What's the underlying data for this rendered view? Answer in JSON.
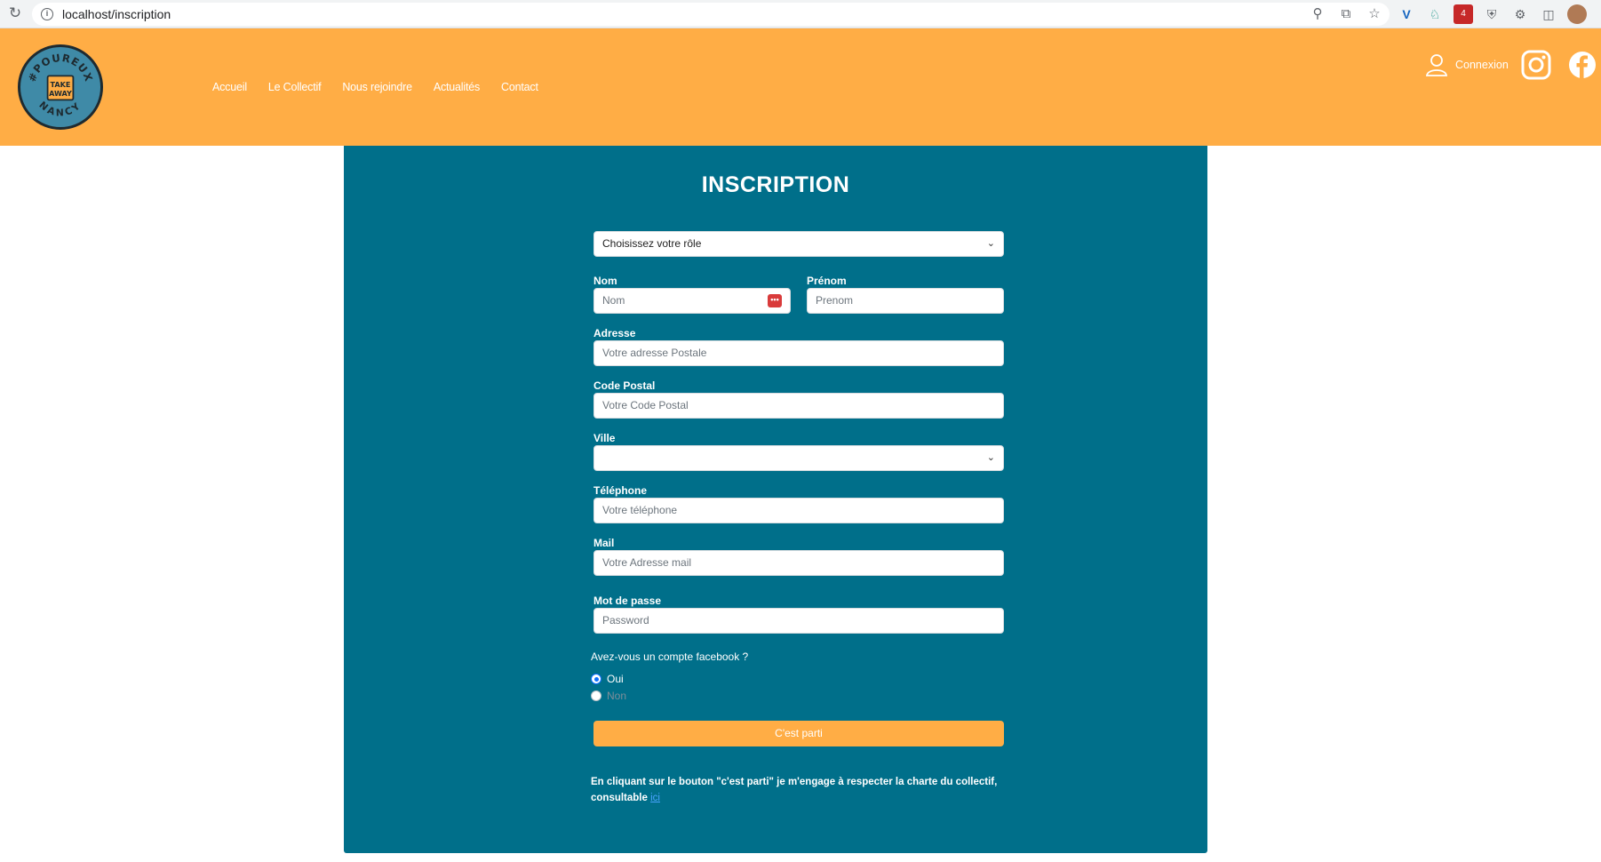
{
  "browser": {
    "url": "localhost/inscription",
    "reload_icon": "reload-icon",
    "extension_badge": "4"
  },
  "header": {
    "logo": {
      "top_text": "#POUREUX",
      "bottom_text": "NANCY",
      "center_lines": [
        "TAKE",
        "AWAY"
      ]
    },
    "nav": [
      "Accueil",
      "Le Collectif",
      "Nous rejoindre",
      "Actualités",
      "Contact"
    ],
    "login_label": "Connexion",
    "colors": {
      "header_bg": "#ffad45",
      "card_bg": "#006f8a",
      "button_bg": "#ffad45"
    }
  },
  "form": {
    "title": "INSCRIPTION",
    "role_select": "Choisissez votre rôle",
    "nom": {
      "label": "Nom",
      "placeholder": "Nom"
    },
    "prenom": {
      "label": "Prénom",
      "placeholder": "Prenom"
    },
    "adresse": {
      "label": "Adresse",
      "placeholder": "Votre adresse Postale"
    },
    "code_postal": {
      "label": "Code Postal",
      "placeholder": "Votre Code Postal"
    },
    "ville": {
      "label": "Ville",
      "value": ""
    },
    "telephone": {
      "label": "Téléphone",
      "placeholder": "Votre téléphone"
    },
    "mail": {
      "label": "Mail",
      "placeholder": "Votre Adresse mail"
    },
    "password": {
      "label": "Mot de passe",
      "placeholder": "Password"
    },
    "facebook_question": "Avez-vous un compte facebook ?",
    "radio_yes": "Oui",
    "radio_no": "Non",
    "submit_label": "C'est parti",
    "disclaimer_text": "En cliquant sur le bouton \"c'est parti\" je m'engage à respecter la charte du collectif, consultable",
    "disclaimer_link": "ici"
  }
}
